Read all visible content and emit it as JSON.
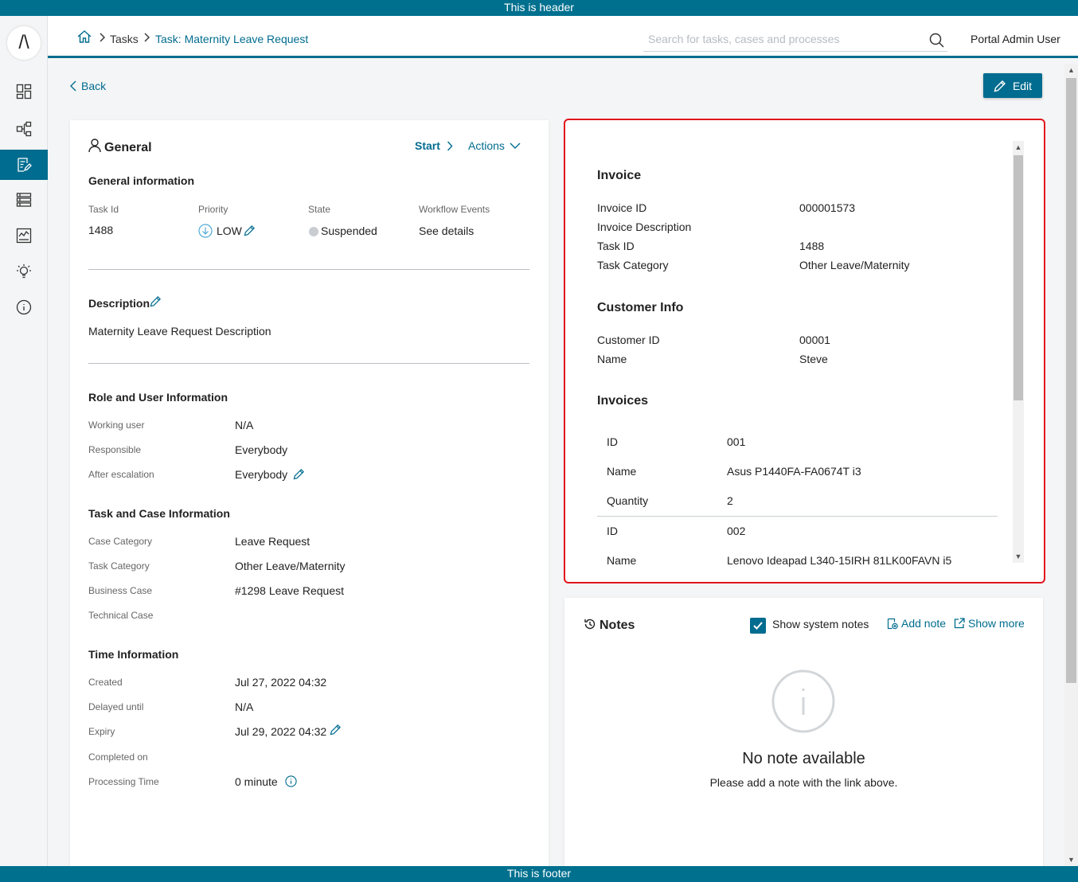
{
  "banner": {
    "header": "This is header",
    "footer": "This is footer"
  },
  "sidebar": {
    "logo": "/\\",
    "items": [
      {
        "name": "dashboard",
        "icon": "dashboard-icon"
      },
      {
        "name": "processes",
        "icon": "process-icon"
      },
      {
        "name": "tasks",
        "icon": "tasks-icon",
        "active": true
      },
      {
        "name": "cases",
        "icon": "cases-icon"
      },
      {
        "name": "statistics",
        "icon": "statistics-icon"
      },
      {
        "name": "ideas",
        "icon": "lightbulb-icon"
      },
      {
        "name": "info",
        "icon": "info-icon"
      }
    ]
  },
  "header": {
    "breadcrumb": {
      "tasks": "Tasks",
      "current": "Task: Maternity Leave Request"
    },
    "search_placeholder": "Search for tasks, cases and processes",
    "user": "Portal Admin User"
  },
  "toolbar": {
    "back": "Back",
    "edit": "Edit"
  },
  "general": {
    "title": "General",
    "start": "Start",
    "actions": "Actions",
    "info_title": "General information",
    "task_id_label": "Task Id",
    "task_id": "1488",
    "priority_label": "Priority",
    "priority": "LOW",
    "state_label": "State",
    "state": "Suspended",
    "workflow_label": "Workflow Events",
    "workflow_link": "See details",
    "description_title": "Description",
    "description": "Maternity Leave Request Description",
    "role_title": "Role and User Information",
    "working_user_label": "Working user",
    "working_user": "N/A",
    "responsible_label": "Responsible",
    "responsible": "Everybody",
    "after_escalation_label": "After escalation",
    "after_escalation": "Everybody",
    "taskcase_title": "Task and Case Information",
    "case_category_label": "Case Category",
    "case_category": "Leave Request",
    "task_category_label": "Task Category",
    "task_category": "Other Leave/Maternity",
    "business_case_label": "Business Case",
    "business_case": "#1298 Leave Request",
    "technical_case_label": "Technical Case",
    "time_title": "Time Information",
    "created_label": "Created",
    "created": "Jul 27, 2022 04:32",
    "delayed_label": "Delayed until",
    "delayed": "N/A",
    "expiry_label": "Expiry",
    "expiry": "Jul 29, 2022 04:32",
    "completed_label": "Completed on",
    "processing_label": "Processing Time",
    "processing": "0 minute"
  },
  "invoice": {
    "title": "Invoice",
    "invoice_id_label": "Invoice ID",
    "invoice_id": "000001573",
    "invoice_desc_label": "Invoice Description",
    "task_id_label": "Task ID",
    "task_id": "1488",
    "task_category_label": "Task Category",
    "task_category": "Other Leave/Maternity",
    "customer_title": "Customer Info",
    "customer_id_label": "Customer ID",
    "customer_id": "00001",
    "name_label": "Name",
    "name": "Steve",
    "invoices_title": "Invoices",
    "items": [
      {
        "id_label": "ID",
        "id": "001",
        "name_label": "Name",
        "name": "Asus P1440FA-FA0674T i3",
        "qty_label": "Quantity",
        "qty": "2"
      },
      {
        "id_label": "ID",
        "id": "002",
        "name_label": "Name",
        "name": "Lenovo Ideapad L340-15IRH 81LK00FAVN i5"
      }
    ]
  },
  "notes": {
    "title": "Notes",
    "show_system": "Show system notes",
    "add_note": "Add note",
    "show_more": "Show more",
    "empty_title": "No note available",
    "empty_hint": "Please add a note with the link above."
  },
  "colors": {
    "accent": "#006c8f",
    "highlight_border": "#e3141d"
  }
}
